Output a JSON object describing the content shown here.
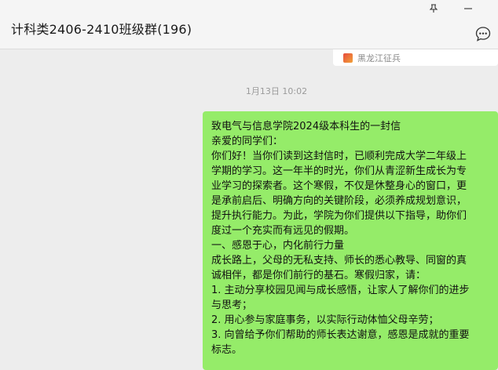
{
  "window": {
    "pin_icon": "pin-icon",
    "minimize_icon": "minimize-icon"
  },
  "header": {
    "title": "计科类2406-2410班级群(196)",
    "more_icon": "chat-more-icon"
  },
  "previous_card": {
    "source": "黑龙江征兵",
    "icon": "source-logo-icon"
  },
  "timestamp": "1月13日 10:02",
  "message": {
    "bubble_color": "#95ec69",
    "lines": [
      "致电气与信息学院2024级本科生的一封信",
      "亲爱的同学们：",
      "你们好！当你们读到这封信时，已顺利完成大学二年级上",
      "学期的学习。这一年半的时光，你们从青涩新生成长为专",
      "业学习的探索者。这个寒假，不仅是休整身心的窗口，更",
      "是承前启后、明确方向的关键阶段，必须养成规划意识，",
      "提升执行能力。为此，学院为你们提供以下指导，助你们",
      "度过一个充实而有远见的假期。",
      "一、感恩于心，内化前行力量",
      "成长路上，父母的无私支持、师长的悉心教导、同窗的真",
      "诚相伴，都是你们前行的基石。寒假归家，请：",
      "1. 主动分享校园见闻与成长感悟，让家人了解你们的进步",
      "与思考；",
      "2. 用心参与家庭事务，以实际行动体恤父母辛劳；",
      "3. 向曾给予你们帮助的师长表达谢意，感恩是成就的重要",
      "标志。"
    ]
  }
}
